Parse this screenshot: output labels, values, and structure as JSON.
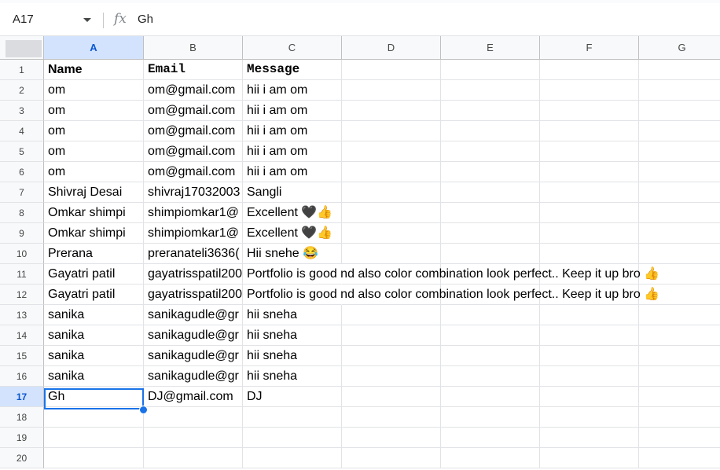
{
  "name_box": "A17",
  "fx_label": "fx",
  "formula_value": "Gh",
  "columns": [
    "A",
    "B",
    "C",
    "D",
    "E",
    "F",
    "G"
  ],
  "selected_column": "A",
  "selected_row": "17",
  "rows": [
    {
      "num": "1",
      "cells": [
        "Name",
        "Email",
        "Message"
      ]
    },
    {
      "num": "2",
      "cells": [
        "om",
        "om@gmail.com",
        "hii i am om"
      ]
    },
    {
      "num": "3",
      "cells": [
        "om",
        "om@gmail.com",
        "hii i am om"
      ]
    },
    {
      "num": "4",
      "cells": [
        "om",
        "om@gmail.com",
        "hii i am om"
      ]
    },
    {
      "num": "5",
      "cells": [
        "om",
        "om@gmail.com",
        "hii i am om"
      ]
    },
    {
      "num": "6",
      "cells": [
        "om",
        "om@gmail.com",
        "hii i am om"
      ]
    },
    {
      "num": "7",
      "cells": [
        "Shivraj Desai",
        "shivraj17032003",
        "Sangli"
      ]
    },
    {
      "num": "8",
      "cells": [
        "Omkar shimpi",
        "shimpiomkar1@",
        "Excellent 🖤👍"
      ]
    },
    {
      "num": "9",
      "cells": [
        "Omkar shimpi",
        "shimpiomkar1@",
        "Excellent 🖤👍"
      ]
    },
    {
      "num": "10",
      "cells": [
        "Prerana",
        "preranateli3636(",
        "Hii snehe 😂"
      ]
    },
    {
      "num": "11",
      "cells": [
        "Gayatri patil",
        "gayatrisspatil200",
        "Portfolio is good nd also color combination look perfect.. Keep it up bro 👍"
      ]
    },
    {
      "num": "12",
      "cells": [
        "Gayatri patil",
        "gayatrisspatil200",
        "Portfolio is good nd also color combination look perfect.. Keep it up bro 👍"
      ]
    },
    {
      "num": "13",
      "cells": [
        "sanika",
        "sanikagudle@gr",
        "hii sneha"
      ]
    },
    {
      "num": "14",
      "cells": [
        "sanika",
        "sanikagudle@gr",
        "hii sneha"
      ]
    },
    {
      "num": "15",
      "cells": [
        "sanika",
        "sanikagudle@gr",
        "hii sneha"
      ]
    },
    {
      "num": "16",
      "cells": [
        "sanika",
        "sanikagudle@gr",
        "hii sneha"
      ]
    },
    {
      "num": "17",
      "cells": [
        "Gh",
        "DJ@gmail.com",
        "DJ"
      ]
    },
    {
      "num": "18",
      "cells": [
        "",
        "",
        ""
      ]
    },
    {
      "num": "19",
      "cells": [
        "",
        "",
        ""
      ]
    },
    {
      "num": "20",
      "cells": [
        "",
        "",
        ""
      ]
    }
  ],
  "colors": {
    "selection": "#1a73e8",
    "header_selected": "#d3e3fd"
  }
}
